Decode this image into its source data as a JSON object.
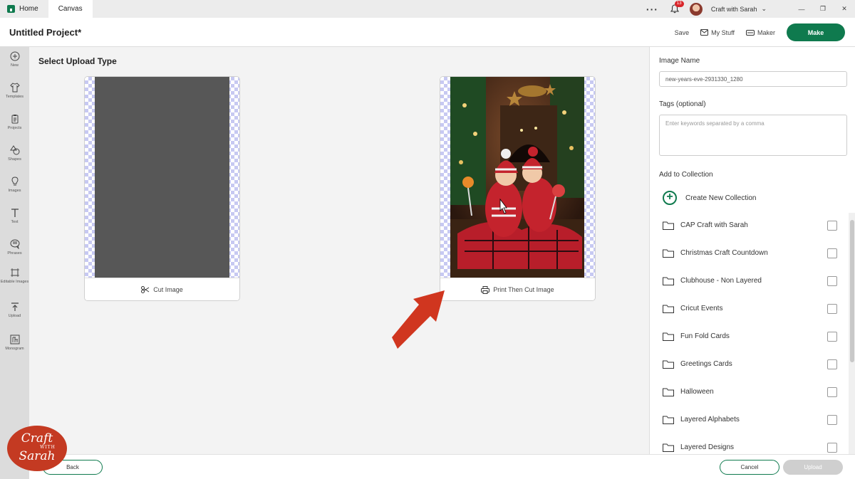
{
  "tabs": {
    "home": "Home",
    "canvas": "Canvas"
  },
  "topbar": {
    "notification_count": "13",
    "user_name": "Craft with Sarah"
  },
  "header": {
    "project_title": "Untitled Project*",
    "save": "Save",
    "my_stuff": "My Stuff",
    "maker": "Maker",
    "make": "Make"
  },
  "sidebar": {
    "items": [
      {
        "label": "New",
        "icon": "plus-circle-icon"
      },
      {
        "label": "Templates",
        "icon": "shirt-icon"
      },
      {
        "label": "Projects",
        "icon": "clipboard-icon"
      },
      {
        "label": "Shapes",
        "icon": "shapes-icon"
      },
      {
        "label": "Images",
        "icon": "lightbulb-icon"
      },
      {
        "label": "Text",
        "icon": "text-icon"
      },
      {
        "label": "Phrases",
        "icon": "speech-bubble-icon"
      },
      {
        "label": "Editable Images",
        "icon": "editable-image-icon"
      },
      {
        "label": "Upload",
        "icon": "upload-icon"
      },
      {
        "label": "Monogram",
        "icon": "monogram-icon"
      }
    ]
  },
  "main": {
    "title": "Select Upload Type",
    "cut_image": "Cut Image",
    "print_then_cut": "Print Then Cut Image"
  },
  "panel": {
    "image_name_label": "Image Name",
    "image_name_value": "new-years-eve-2931330_1280",
    "tags_label": "Tags (optional)",
    "tags_placeholder": "Enter keywords separated by a comma",
    "add_collection_label": "Add to Collection",
    "create_collection": "Create New Collection",
    "collections": [
      "CAP Craft with Sarah",
      "Christmas Craft Countdown",
      "Clubhouse - Non Layered",
      "Cricut Events",
      "Fun Fold Cards",
      "Greetings Cards",
      "Halloween",
      "Layered Alphabets",
      "Layered Designs"
    ]
  },
  "footer": {
    "back": "Back",
    "cancel": "Cancel",
    "upload": "Upload"
  },
  "logo": {
    "line1": "Craft",
    "with": "WITH",
    "line2": "Sarah"
  },
  "colors": {
    "brand_green": "#0f7a4e",
    "arrow_red": "#d0361f",
    "sidebar_bg": "#dcdcdc"
  }
}
